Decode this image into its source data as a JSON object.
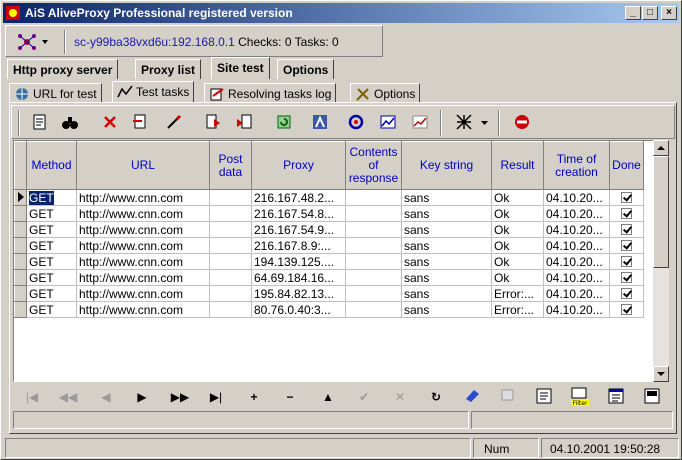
{
  "window": {
    "title": "AiS AliveProxy Professional registered version",
    "minimize": "_",
    "maximize": "□",
    "close": "×"
  },
  "connection": {
    "host": "sc-y99ba38vxd6u:192.168.0.1",
    "checks_label": "Checks:",
    "checks_value": "0",
    "tasks_label": "Tasks:",
    "tasks_value": "0"
  },
  "main_tabs": [
    "Http proxy server",
    "Proxy list",
    "Site test",
    "Options"
  ],
  "main_tab_active": "Site test",
  "sub_tabs": [
    "URL for test",
    "Test tasks",
    "Resolving tasks log",
    "Options"
  ],
  "sub_tab_active": "Test tasks",
  "grid": {
    "columns": [
      "Method",
      "URL",
      "Post data",
      "Proxy",
      "Contents of response",
      "Key string",
      "Result",
      "Time of creation",
      "Done"
    ],
    "rows": [
      {
        "method": "GET",
        "url": "http://www.cnn.com",
        "post": "",
        "proxy": "216.167.48.2...",
        "contents": "",
        "key": "sans",
        "result": "Ok",
        "time": "04.10.20...",
        "done": true
      },
      {
        "method": "GET",
        "url": "http://www.cnn.com",
        "post": "",
        "proxy": "216.167.54.8...",
        "contents": "",
        "key": "sans",
        "result": "Ok",
        "time": "04.10.20...",
        "done": true
      },
      {
        "method": "GET",
        "url": "http://www.cnn.com",
        "post": "",
        "proxy": "216.167.54.9...",
        "contents": "",
        "key": "sans",
        "result": "Ok",
        "time": "04.10.20...",
        "done": true
      },
      {
        "method": "GET",
        "url": "http://www.cnn.com",
        "post": "",
        "proxy": "216.167.8.9:...",
        "contents": "",
        "key": "sans",
        "result": "Ok",
        "time": "04.10.20...",
        "done": true
      },
      {
        "method": "GET",
        "url": "http://www.cnn.com",
        "post": "",
        "proxy": "194.139.125....",
        "contents": "",
        "key": "sans",
        "result": "Ok",
        "time": "04.10.20...",
        "done": true
      },
      {
        "method": "GET",
        "url": "http://www.cnn.com",
        "post": "",
        "proxy": "64.69.184.16...",
        "contents": "",
        "key": "sans",
        "result": "Ok",
        "time": "04.10.20...",
        "done": true
      },
      {
        "method": "GET",
        "url": "http://www.cnn.com",
        "post": "",
        "proxy": "195.84.82.13...",
        "contents": "",
        "key": "sans",
        "result": "Error:...",
        "time": "04.10.20...",
        "done": true
      },
      {
        "method": "GET",
        "url": "http://www.cnn.com",
        "post": "",
        "proxy": "80.76.0.40:3...",
        "contents": "",
        "key": "sans",
        "result": "Error:...",
        "time": "04.10.20...",
        "done": true
      }
    ]
  },
  "navigator": {
    "first": "|◀",
    "prior_page": "◀◀",
    "prior": "◀",
    "next": "▶",
    "next_page": "▶▶",
    "last": "▶|",
    "insert": "+",
    "delete": "−",
    "edit": "▲",
    "post": "✔",
    "cancel": "✕",
    "refresh": "↻",
    "filter_label": "Filter"
  },
  "status": {
    "num": "Num",
    "datetime": "04.10.2001 19:50:28"
  }
}
